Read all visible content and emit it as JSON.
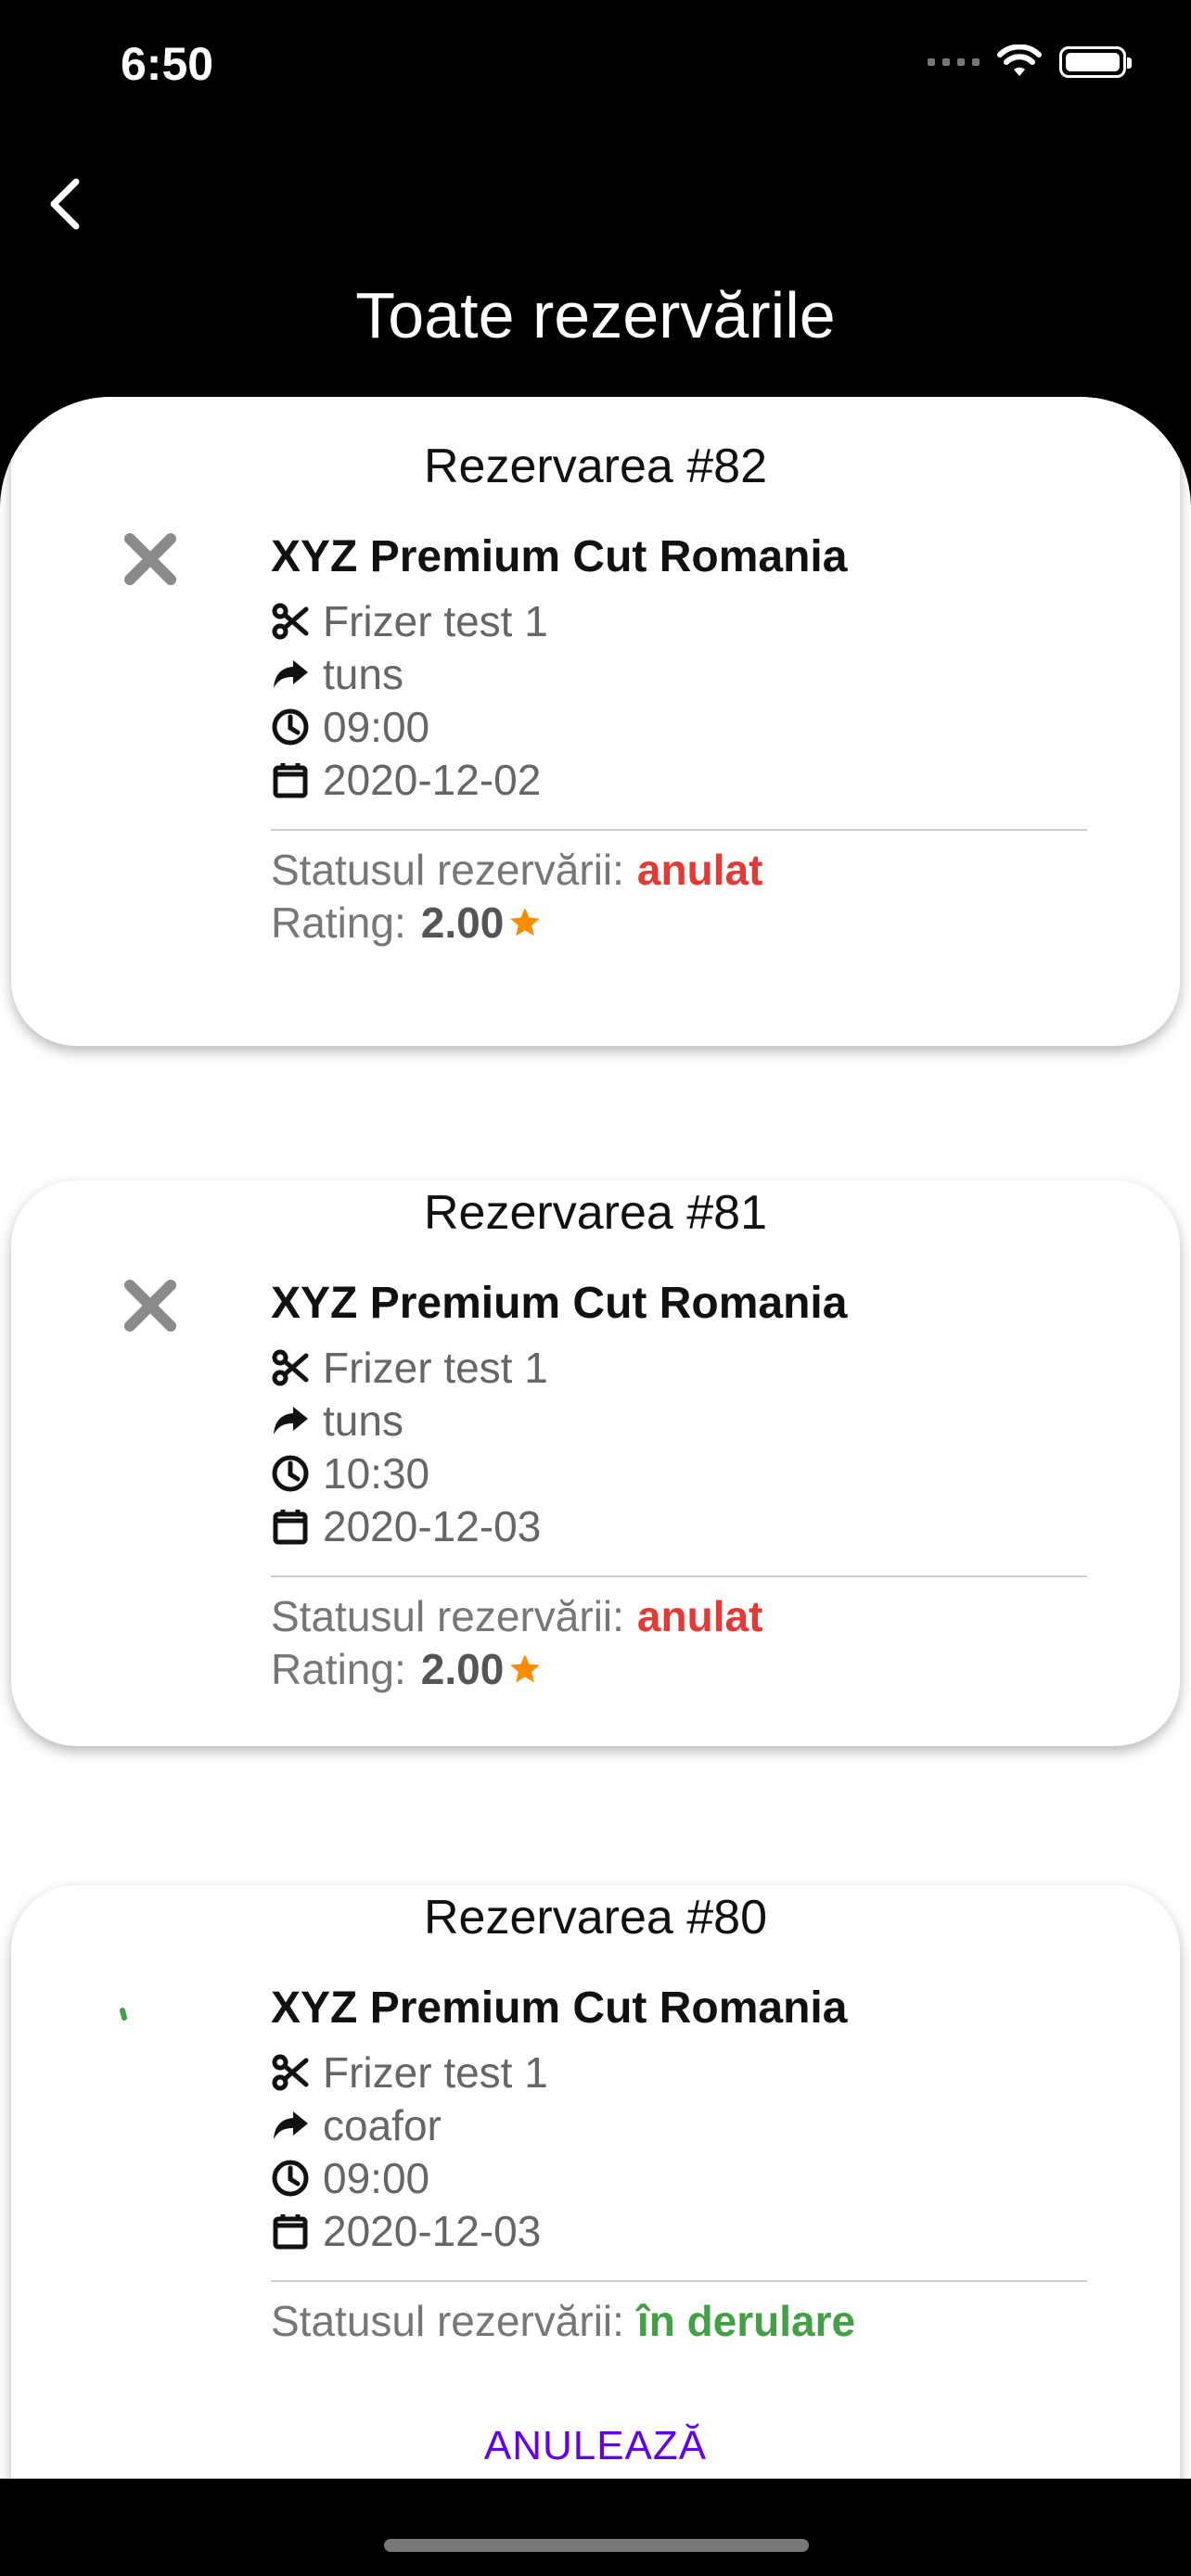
{
  "status_bar": {
    "time": "6:50"
  },
  "header": {
    "title": "Toate rezervările",
    "back_icon": "chevron-left-icon"
  },
  "colors": {
    "cancelled": "#E53935",
    "in_progress": "#43A047",
    "star": "#FB8C00",
    "accent": "#6200EE"
  },
  "labels": {
    "status_prefix": "Statusul rezervării:",
    "rating_prefix": "Rating:"
  },
  "reservations": [
    {
      "title": "Rezervarea #82",
      "shop": "XYZ Premium Cut Romania",
      "barber": "Frizer test 1",
      "service": "tuns",
      "time": "09:00",
      "date": "2020-12-02",
      "status": "anulat",
      "status_icon": "close-icon",
      "rating": "2.00"
    },
    {
      "title": "Rezervarea #81",
      "shop": "XYZ Premium Cut Romania",
      "barber": "Frizer test 1",
      "service": "tuns",
      "time": "10:30",
      "date": "2020-12-03",
      "status": "anulat",
      "status_icon": "close-icon",
      "rating": "2.00"
    },
    {
      "title": "Rezervarea #80",
      "shop": "XYZ Premium Cut Romania",
      "barber": "Frizer test 1",
      "service": "coafor",
      "time": "09:00",
      "date": "2020-12-03",
      "status": "în derulare",
      "status_icon": "loading-spinner-icon",
      "cancel_label": "ANULEAZĂ"
    }
  ]
}
